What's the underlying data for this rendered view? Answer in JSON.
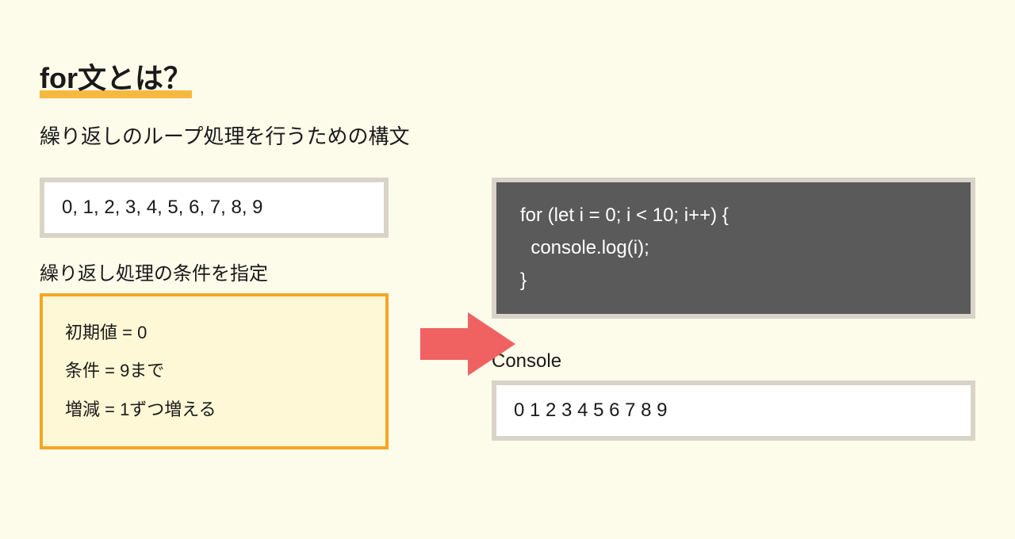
{
  "title": "for文とは？",
  "subtitle": "繰り返しのループ処理を行うための構文",
  "left": {
    "output": "0, 1, 2, 3, 4, 5, 6, 7, 8, 9",
    "condition_label": "繰り返し処理の条件を指定",
    "condition_initial": "初期値 = 0",
    "condition_range": "条件 = 9まで",
    "condition_step": "増減 = 1ずつ増える"
  },
  "right": {
    "code": "for (let i = 0; i < 10; i++) {\n  console.log(i);\n}",
    "console_label": "Console",
    "console_output": "0 1 2 3 4 5 6 7 8 9"
  }
}
